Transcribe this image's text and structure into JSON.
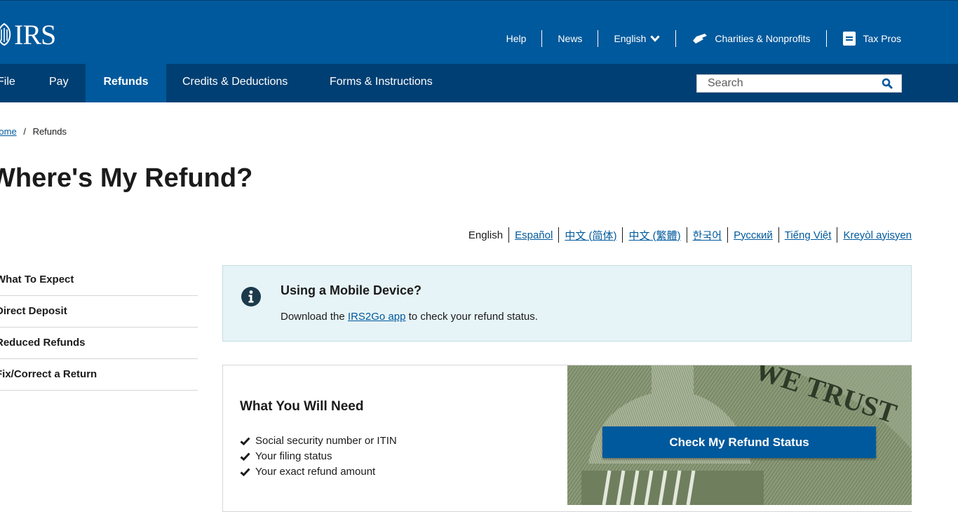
{
  "header": {
    "logo_text": "IRS",
    "utility": {
      "help": "Help",
      "news": "News",
      "language": "English",
      "charities": "Charities & Nonprofits",
      "tax_pros": "Tax Pros"
    }
  },
  "nav": {
    "items": [
      "File",
      "Pay",
      "Refunds",
      "Credits & Deductions",
      "Forms & Instructions"
    ],
    "active": "Refunds",
    "search_placeholder": "Search"
  },
  "breadcrumb": {
    "home": "Home",
    "separator": "/",
    "current": "Refunds"
  },
  "page": {
    "title": "Where's My Refund?"
  },
  "languages": [
    "English",
    "Español",
    "中文 (简体)",
    "中文 (繁體)",
    "한국어",
    "Русский",
    "Tiếng Việt",
    "Kreyòl ayisyen"
  ],
  "sidenav": {
    "items": [
      "What To Expect",
      "Direct Deposit",
      "Reduced Refunds",
      "Fix/Correct a Return"
    ]
  },
  "alert": {
    "title": "Using a Mobile Device?",
    "body_prefix": "Download the",
    "link": "IRS2Go app",
    "body_suffix": "to check your refund status."
  },
  "card": {
    "title": "What You Will Need",
    "items": [
      "Social security number or ITIN",
      "Your filing status",
      "Your exact refund amount"
    ],
    "cta": "Check My Refund Status",
    "hero_text": "WE TRUST"
  },
  "colors": {
    "primary": "#00599c",
    "nav_dark": "#003f73",
    "alert_bg": "#e7f4f7",
    "text": "#1b1b1b"
  }
}
